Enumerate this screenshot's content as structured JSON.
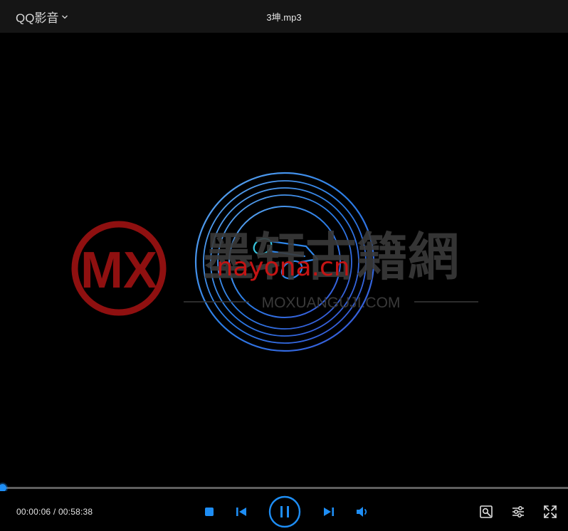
{
  "app": {
    "name": "QQ影音",
    "file_title": "3坤.mp3"
  },
  "watermark": {
    "logo_text": "MX",
    "site_name": "墨轩古籍網",
    "overlay_text": "nayona.cn",
    "domain_text": "MOXUANGUJI.COM"
  },
  "playback": {
    "current_time": "00:00:06",
    "total_time": "00:58:38",
    "progress_fraction": 0.0017
  },
  "controls": {
    "stop_icon": "stop-icon",
    "previous_icon": "skip-previous-icon",
    "play_pause_icon": "pause-icon",
    "next_icon": "skip-next-icon",
    "volume_icon": "volume-icon",
    "tools_icon": "toolbox-icon",
    "settings_icon": "equalizer-settings-icon",
    "fullscreen_icon": "fullscreen-icon"
  },
  "colors": {
    "accent": "#1e8ef5",
    "ring": "#2d7fe8",
    "watermark_red": "#8f1010",
    "watermark_grey": "#3a3a3a"
  }
}
